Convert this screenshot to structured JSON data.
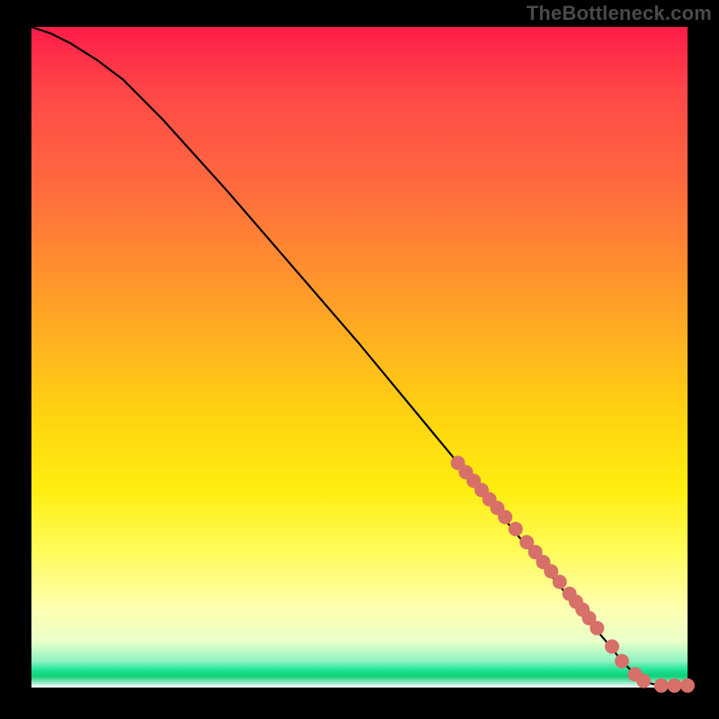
{
  "brand": "TheBottleneck.com",
  "chart_data": {
    "type": "line",
    "title": "",
    "xlabel": "",
    "ylabel": "",
    "xlim": [
      0,
      100
    ],
    "ylim": [
      0,
      100
    ],
    "grid": false,
    "series": [
      {
        "name": "curve",
        "x": [
          0,
          3,
          6,
          10,
          14,
          20,
          30,
          40,
          50,
          60,
          65,
          70,
          75,
          80,
          85,
          88,
          90,
          92,
          94,
          96,
          98,
          100
        ],
        "y": [
          100,
          99,
          97.5,
          95,
          92,
          86,
          75,
          63.5,
          52,
          40,
          34,
          28,
          22,
          16,
          10,
          6.5,
          4,
          2,
          0.7,
          0.3,
          0.3,
          0.3
        ]
      }
    ],
    "points": {
      "name": "markers",
      "x": [
        65,
        66.2,
        67.4,
        68.6,
        69.8,
        71,
        72.2,
        73.8,
        75.5,
        76.8,
        78,
        79.2,
        80.5,
        82,
        83,
        84,
        85,
        86.2,
        88.5,
        90,
        92,
        93.3,
        96,
        98,
        100
      ],
      "y": [
        34,
        32.6,
        31.3,
        29.9,
        28.5,
        27.2,
        25.8,
        24,
        22,
        20.5,
        19,
        17.6,
        16,
        14.2,
        13,
        11.8,
        10.5,
        9,
        6.2,
        4,
        2,
        1,
        0.3,
        0.3,
        0.3
      ]
    },
    "gradient_stops": [
      {
        "pos": 0,
        "color": "#ff1c48"
      },
      {
        "pos": 50,
        "color": "#ffc81a"
      },
      {
        "pos": 80,
        "color": "#fffc60"
      },
      {
        "pos": 97,
        "color": "#29e59b"
      },
      {
        "pos": 100,
        "color": "#ffffff"
      }
    ]
  }
}
